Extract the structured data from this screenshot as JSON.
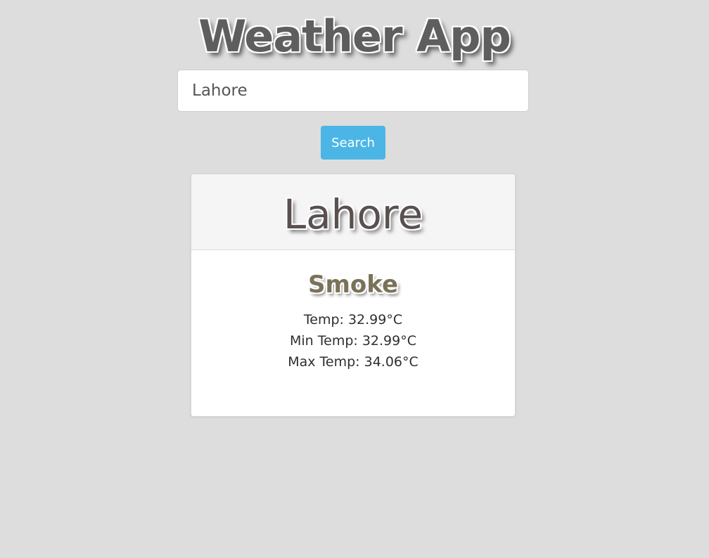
{
  "header": {
    "title": "Weather App"
  },
  "search": {
    "value": "Lahore",
    "button_label": "Search"
  },
  "result": {
    "city": "Lahore",
    "condition": "Smoke",
    "temp": "Temp: 32.99°C",
    "min_temp": "Min Temp: 32.99°C",
    "max_temp": "Max Temp: 34.06°C"
  },
  "colors": {
    "background": "#dddddd",
    "button": "#4bb6e6",
    "card_header": "#f5f5f5"
  }
}
